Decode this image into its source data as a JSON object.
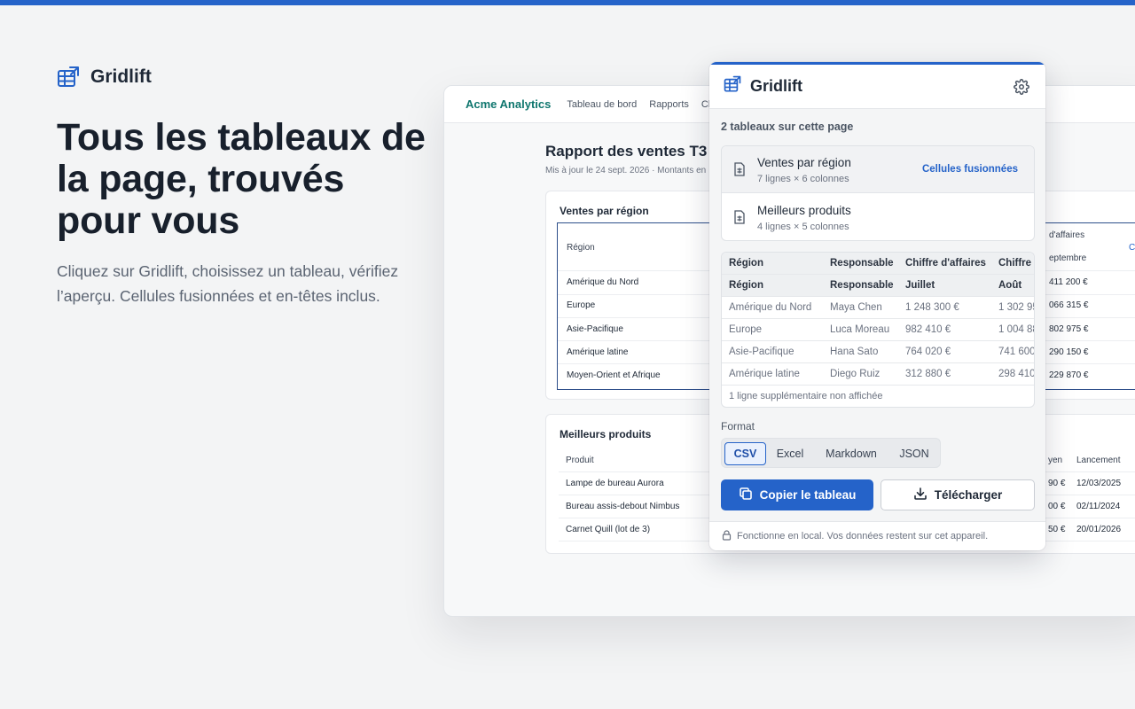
{
  "hero": {
    "brand": "Gridlift",
    "title": "Tous les tableaux de la page, trouvés pour vous",
    "subtitle": "Cliquez sur Gridlift, choisissez un tableau, vérifiez l’aperçu. Cellules fusionnées et en-têtes inclus."
  },
  "background_page": {
    "logo": "Acme Analytics",
    "nav": [
      "Tableau de bord",
      "Rapports",
      "Cli"
    ],
    "report_title": "Rapport des ventes T3",
    "report_meta": "Mis à jour le 24 sept. 2026 · Montants en",
    "table1": {
      "title": "Ventes par région",
      "head_col1": "Région",
      "head_right_top": "d'affaires",
      "head_right_sub": "eptembre",
      "head_right_edge": "C",
      "rows": [
        {
          "region": "Amérique du Nord",
          "value": "411 200 €"
        },
        {
          "region": "Europe",
          "value": "066 315 €"
        },
        {
          "region": "Asie-Pacifique",
          "value": "802 975 €"
        },
        {
          "region": "Amérique latine",
          "value": "290 150 €"
        },
        {
          "region": "Moyen-Orient et Afrique",
          "value": "229 870 €"
        }
      ]
    },
    "table2": {
      "title": "Meilleurs produits",
      "head_col1": "Produit",
      "head_mid": "yen",
      "head_right": "Lancement",
      "rows": [
        {
          "product": "Lampe de bureau Aurora",
          "mid": "90 €",
          "date": "12/03/2025"
        },
        {
          "product": "Bureau assis-debout Nimbus",
          "mid": "00 €",
          "date": "02/11/2024"
        },
        {
          "product": "Carnet Quill (lot de 3)",
          "mid": "50 €",
          "date": "20/01/2026"
        }
      ]
    }
  },
  "popup": {
    "title": "Gridlift",
    "count_label": "2 tableaux sur cette page",
    "tables": [
      {
        "name": "Ventes par région",
        "dims": "7 lignes × 6 colonnes",
        "badge": "Cellules fusionnées"
      },
      {
        "name": "Meilleurs produits",
        "dims": "4 lignes × 5 colonnes",
        "badge": ""
      }
    ],
    "preview": {
      "header1": [
        "Région",
        "Responsable",
        "Chiffre d'affaires",
        "Chiffre d"
      ],
      "header2": [
        "Région",
        "Responsable",
        "Juillet",
        "Août"
      ],
      "rows": [
        [
          "Amérique du Nord",
          "Maya Chen",
          "1 248 300 €",
          "1 302 95"
        ],
        [
          "Europe",
          "Luca Moreau",
          "982 410 €",
          "1 004 88"
        ],
        [
          "Asie-Pacifique",
          "Hana Sato",
          "764 020 €",
          "741 600"
        ],
        [
          "Amérique latine",
          "Diego Ruiz",
          "312 880 €",
          "298 410"
        ]
      ],
      "more": "1 ligne supplémentaire non affichée"
    },
    "format_label": "Format",
    "formats": [
      "CSV",
      "Excel",
      "Markdown",
      "JSON"
    ],
    "selected_format": "CSV",
    "copy_label": "Copier le tableau",
    "download_label": "Télécharger",
    "footer": "Fonctionne en local. Vos données restent sur cet appareil.",
    "accent": "#2563c9"
  }
}
